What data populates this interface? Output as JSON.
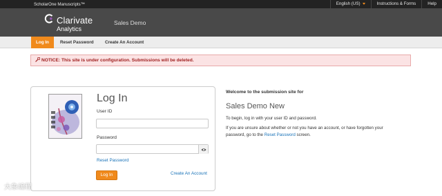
{
  "topbar": {
    "brand": "ScholarOne Manuscripts™",
    "language": "English (US)",
    "instructions": "Instructions & Forms",
    "help": "Help"
  },
  "header": {
    "logo_line1": "Clarivate",
    "logo_line2": "Analytics",
    "site_name": "Sales Demo"
  },
  "nav": {
    "tabs": [
      {
        "label": "Log In",
        "active": true
      },
      {
        "label": "Reset Password",
        "active": false
      },
      {
        "label": "Create An Account",
        "active": false
      }
    ]
  },
  "alert": {
    "text": "NOTICE: This site is under configuration. Submissions will be deleted.",
    "icon": "wrench-icon"
  },
  "login": {
    "title": "Log In",
    "user_id_label": "User ID",
    "user_id_value": "",
    "password_label": "Password",
    "password_value": "",
    "reset_link": "Reset Password",
    "submit_label": "Log In",
    "create_link": "Create An Account"
  },
  "welcome": {
    "heading": "Welcome to the submission site for",
    "title": "Sales Demo New",
    "p1": "To begin, log in with your user ID and password.",
    "p2_before": "If you are unsure about whether or not you have an account, or have forgotten your password, go to the ",
    "p2_link": "Reset Password",
    "p2_after": " screen."
  },
  "watermark": "大象编程",
  "colors": {
    "accent": "#f08a1c",
    "link": "#1a73b8",
    "alert_bg": "#fbe3e4",
    "alert_text": "#a02020",
    "header_bg": "#494949",
    "topbar_bg": "#232323"
  }
}
